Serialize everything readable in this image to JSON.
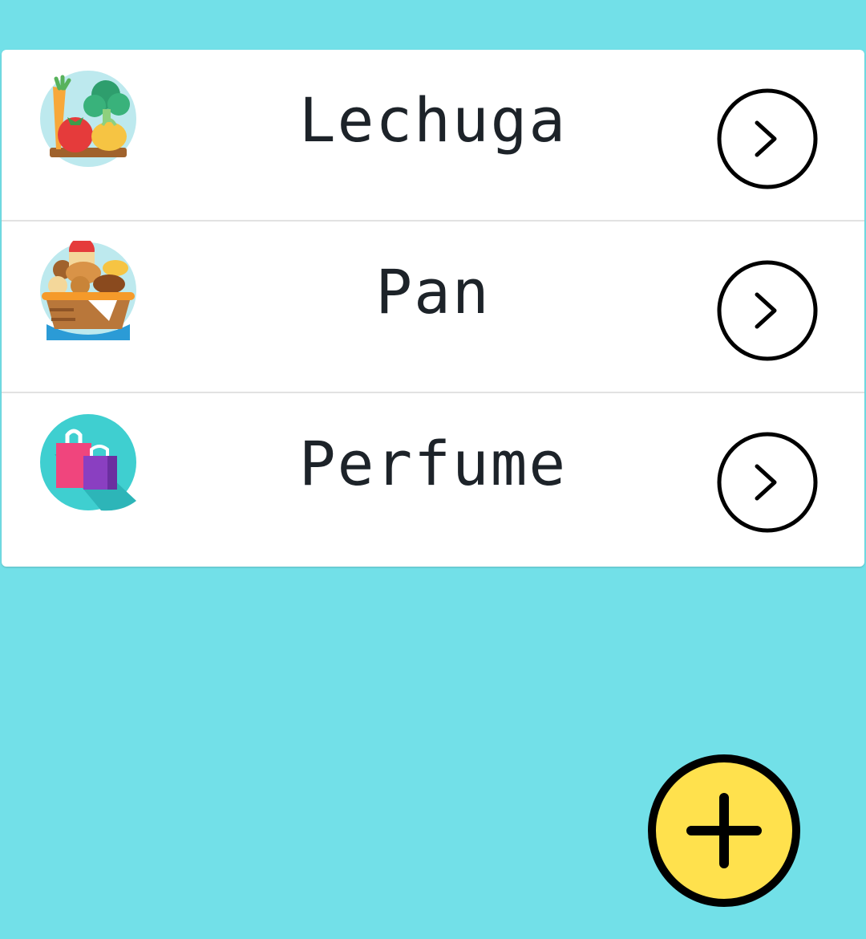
{
  "list": {
    "items": [
      {
        "label": "Lechuga",
        "icon": "vegetables-icon"
      },
      {
        "label": "Pan",
        "icon": "bread-basket-icon"
      },
      {
        "label": "Perfume",
        "icon": "shopping-bags-icon"
      }
    ]
  },
  "fab": {
    "icon": "plus-icon"
  },
  "colors": {
    "background": "#72e0e8",
    "card": "#ffffff",
    "text": "#1d2329",
    "fab_fill": "#ffe14d",
    "outline": "#000000"
  }
}
